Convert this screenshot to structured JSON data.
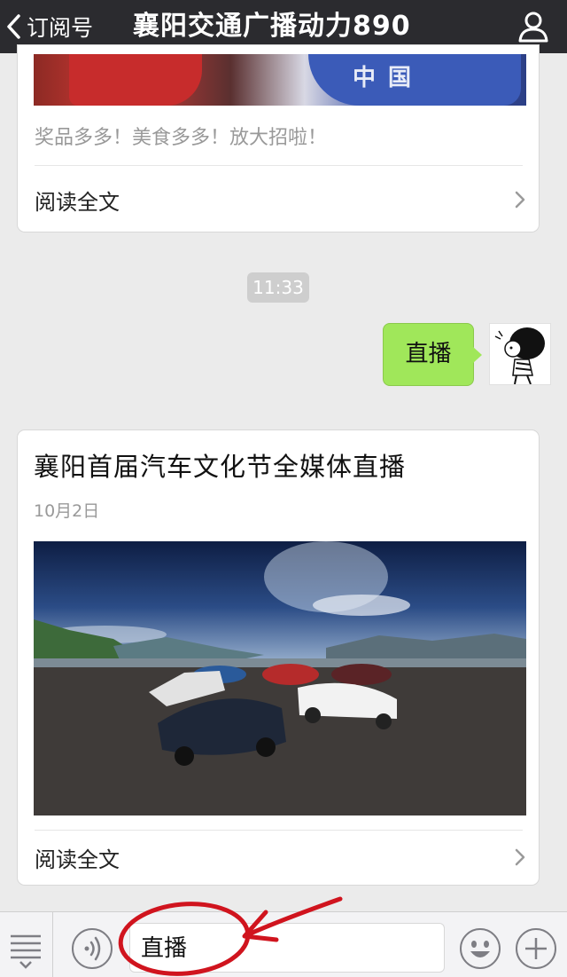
{
  "header": {
    "back_label": "订阅号",
    "title": "襄阳交通广播动力890",
    "bar_color": "#2b2b2f"
  },
  "article_prev": {
    "description": "奖品多多！美食多多！放大招啦！",
    "image_text": "中国",
    "read_more": "阅读全文"
  },
  "timestamp": "11:33",
  "sent_message": {
    "text": "直播",
    "bubble_color": "#a0e75a"
  },
  "article": {
    "title": "襄阳首届汽车文化节全媒体直播",
    "date": "10月2日",
    "read_more": "阅读全文"
  },
  "input_bar": {
    "text": "直播",
    "annotation_color": "#d0141e"
  },
  "icons": {
    "back": "chevron-left-icon",
    "profile": "person-icon",
    "menu": "menu-lines-icon",
    "voice": "voice-icon",
    "emoji": "smiley-icon",
    "plus": "plus-icon"
  }
}
